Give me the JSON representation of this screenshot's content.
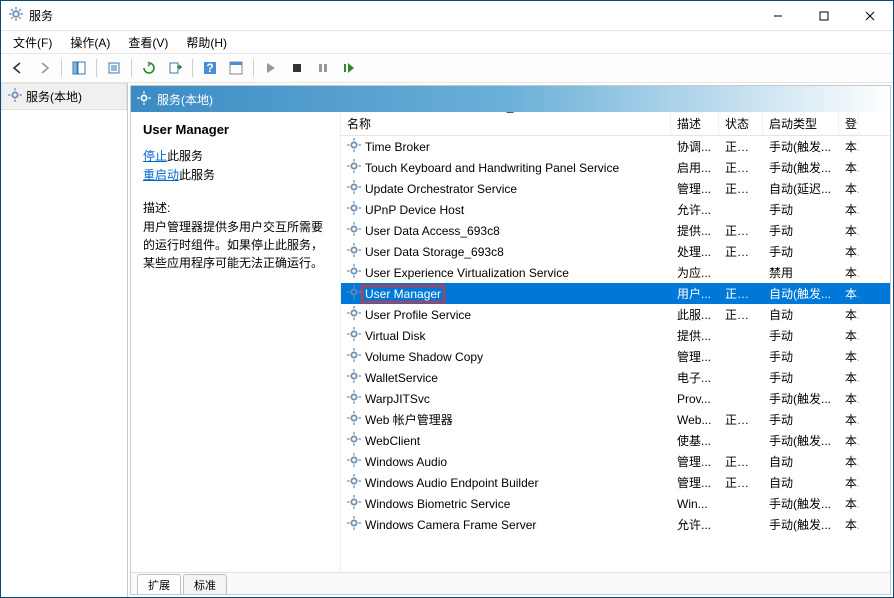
{
  "window": {
    "title": "服务"
  },
  "menu": {
    "file": "文件(F)",
    "action": "操作(A)",
    "view": "查看(V)",
    "help": "帮助(H)"
  },
  "nav": {
    "root": "服务(本地)"
  },
  "detail": {
    "title": "服务(本地)"
  },
  "descpane": {
    "selected_name": "User Manager",
    "stop_link": "停止",
    "stop_suffix": "此服务",
    "restart_link": "重启动",
    "restart_suffix": "此服务",
    "desc_label": "描述:",
    "desc_text": "用户管理器提供多用户交互所需要的运行时组件。如果停止此服务，某些应用程序可能无法正确运行。"
  },
  "columns": {
    "name": "名称",
    "desc": "描述",
    "state": "状态",
    "startup": "启动类型",
    "login": "登"
  },
  "services": [
    {
      "name": "Time Broker",
      "desc": "协调...",
      "state": "正在...",
      "startup": "手动(触发...",
      "login": "本"
    },
    {
      "name": "Touch Keyboard and Handwriting Panel Service",
      "desc": "启用...",
      "state": "正在...",
      "startup": "手动(触发...",
      "login": "本"
    },
    {
      "name": "Update Orchestrator Service",
      "desc": "管理...",
      "state": "正在...",
      "startup": "自动(延迟...",
      "login": "本"
    },
    {
      "name": "UPnP Device Host",
      "desc": "允许...",
      "state": "",
      "startup": "手动",
      "login": "本"
    },
    {
      "name": "User Data Access_693c8",
      "desc": "提供...",
      "state": "正在...",
      "startup": "手动",
      "login": "本"
    },
    {
      "name": "User Data Storage_693c8",
      "desc": "处理...",
      "state": "正在...",
      "startup": "手动",
      "login": "本"
    },
    {
      "name": "User Experience Virtualization Service",
      "desc": "为应...",
      "state": "",
      "startup": "禁用",
      "login": "本"
    },
    {
      "name": "User Manager",
      "desc": "用户...",
      "state": "正在...",
      "startup": "自动(触发...",
      "login": "本",
      "selected": true
    },
    {
      "name": "User Profile Service",
      "desc": "此服...",
      "state": "正在...",
      "startup": "自动",
      "login": "本"
    },
    {
      "name": "Virtual Disk",
      "desc": "提供...",
      "state": "",
      "startup": "手动",
      "login": "本"
    },
    {
      "name": "Volume Shadow Copy",
      "desc": "管理...",
      "state": "",
      "startup": "手动",
      "login": "本"
    },
    {
      "name": "WalletService",
      "desc": "电子...",
      "state": "",
      "startup": "手动",
      "login": "本"
    },
    {
      "name": "WarpJITSvc",
      "desc": "Prov...",
      "state": "",
      "startup": "手动(触发...",
      "login": "本"
    },
    {
      "name": "Web 帐户管理器",
      "desc": "Web...",
      "state": "正在...",
      "startup": "手动",
      "login": "本"
    },
    {
      "name": "WebClient",
      "desc": "使基...",
      "state": "",
      "startup": "手动(触发...",
      "login": "本"
    },
    {
      "name": "Windows Audio",
      "desc": "管理...",
      "state": "正在...",
      "startup": "自动",
      "login": "本"
    },
    {
      "name": "Windows Audio Endpoint Builder",
      "desc": "管理...",
      "state": "正在...",
      "startup": "自动",
      "login": "本"
    },
    {
      "name": "Windows Biometric Service",
      "desc": "Win...",
      "state": "",
      "startup": "手动(触发...",
      "login": "本"
    },
    {
      "name": "Windows Camera Frame Server",
      "desc": "允许...",
      "state": "",
      "startup": "手动(触发...",
      "login": "本"
    }
  ],
  "tabs": {
    "extended": "扩展",
    "standard": "标准"
  }
}
